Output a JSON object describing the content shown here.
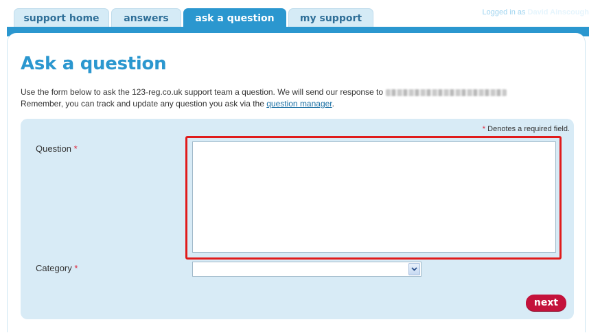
{
  "header": {
    "logged_in_prefix": "Logged in as",
    "user_name": "David Ainscough"
  },
  "tabs": [
    {
      "label": "support home",
      "active": false
    },
    {
      "label": "answers",
      "active": false
    },
    {
      "label": "ask a question",
      "active": true
    },
    {
      "label": "my support",
      "active": false
    }
  ],
  "page": {
    "title": "Ask a question",
    "intro_line1": "Use the form below to ask the 123-reg.co.uk support team a question. We will send our response to",
    "intro_line2_prefix": "Remember, you can track and update any question you ask via the",
    "intro_link": "question manager",
    "intro_line2_suffix": "."
  },
  "form": {
    "required_note": "Denotes a required field.",
    "required_marker": "*",
    "question_label": "Question",
    "question_value": "",
    "category_label": "Category",
    "category_selected": "",
    "next_label": "next"
  },
  "colors": {
    "accent": "#2b97cf",
    "panel": "#d8ebf6",
    "required": "#e0243a",
    "highlight": "#e01b1b",
    "next_button": "#c4123b"
  }
}
